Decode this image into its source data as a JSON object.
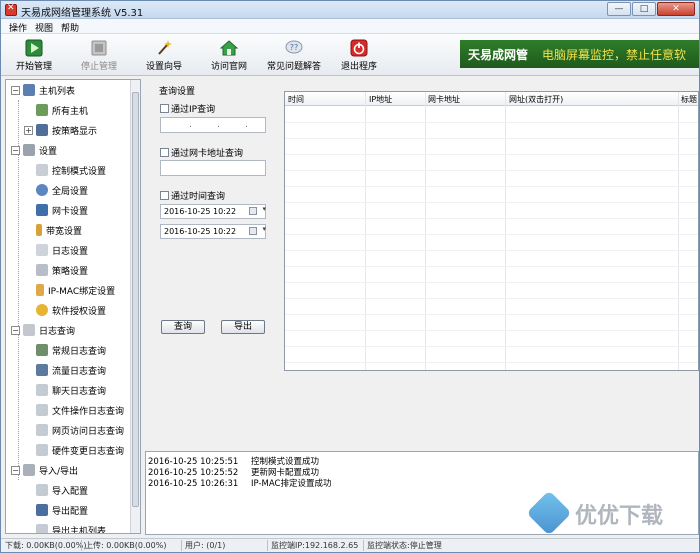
{
  "window": {
    "title": "天易成网络管理系统 V5.31"
  },
  "menu": [
    "操作",
    "视图",
    "帮助"
  ],
  "toolbar": [
    {
      "label": "开始管理",
      "icon": "play-icon",
      "enabled": true
    },
    {
      "label": "停止管理",
      "icon": "stop-icon",
      "enabled": false
    },
    {
      "label": "设置向导",
      "icon": "wand-icon",
      "enabled": true
    },
    {
      "label": "访问官网",
      "icon": "home-icon",
      "enabled": true
    },
    {
      "label": "常见问题解答",
      "icon": "faq-icon",
      "enabled": true
    },
    {
      "label": "退出程序",
      "icon": "power-icon",
      "enabled": true
    }
  ],
  "banner": {
    "brand": "天易成网管",
    "slogan": "电脑屏幕监控，禁止任意软"
  },
  "tree": [
    {
      "label": "主机列表",
      "level": 0,
      "icon": "host-list-icon"
    },
    {
      "label": "所有主机",
      "level": 1,
      "icon": "all-hosts-icon"
    },
    {
      "label": "按策略显示",
      "level": 1,
      "icon": "policy-view-icon"
    },
    {
      "label": "设置",
      "level": 0,
      "icon": "wrench-icon"
    },
    {
      "label": "控制模式设置",
      "level": 1,
      "icon": "control-mode-icon"
    },
    {
      "label": "全局设置",
      "level": 1,
      "icon": "gear-icon"
    },
    {
      "label": "网卡设置",
      "level": 1,
      "icon": "nic-icon"
    },
    {
      "label": "带宽设置",
      "level": 1,
      "icon": "bandwidth-icon"
    },
    {
      "label": "日志设置",
      "level": 1,
      "icon": "log-settings-icon"
    },
    {
      "label": "策略设置",
      "level": 1,
      "icon": "policy-icon"
    },
    {
      "label": "IP-MAC绑定设置",
      "level": 1,
      "icon": "ip-mac-icon"
    },
    {
      "label": "软件授权设置",
      "level": 1,
      "icon": "license-icon"
    },
    {
      "label": "日志查询",
      "level": 0,
      "icon": "log-query-icon"
    },
    {
      "label": "常规日志查询",
      "level": 1,
      "icon": "regular-log-icon"
    },
    {
      "label": "流量日志查询",
      "level": 1,
      "icon": "traffic-log-icon"
    },
    {
      "label": "聊天日志查询",
      "level": 1,
      "icon": "chat-log-icon"
    },
    {
      "label": "文件操作日志查询",
      "level": 1,
      "icon": "file-log-icon"
    },
    {
      "label": "网页访问日志查询",
      "level": 1,
      "icon": "web-log-icon"
    },
    {
      "label": "硬件变更日志查询",
      "level": 1,
      "icon": "hardware-log-icon"
    },
    {
      "label": "导入/导出",
      "level": 0,
      "icon": "import-export-icon"
    },
    {
      "label": "导入配置",
      "level": 1,
      "icon": "import-icon"
    },
    {
      "label": "导出配置",
      "level": 1,
      "icon": "export-icon"
    },
    {
      "label": "导出主机列表",
      "level": 1,
      "icon": "export-hosts-icon"
    }
  ],
  "query": {
    "title": "查询设置",
    "by_ip_label": "通过IP查询",
    "ip_dots": [
      ".",
      ".",
      "."
    ],
    "by_mac_label": "通过网卡地址查询",
    "by_time_label": "通过时间查询",
    "start_time": "2016-10-25 10:22",
    "end_time": "2016-10-25 10:22",
    "search_button": "查询",
    "export_button": "导出"
  },
  "results": {
    "columns": [
      "时间",
      "IP地址",
      "网卡地址",
      "网址(双击打开)",
      "标题"
    ]
  },
  "log": [
    {
      "time": "2016-10-25 10:25:51",
      "message": "控制模式设置成功"
    },
    {
      "time": "2016-10-25 10:25:52",
      "message": "更新网卡配置成功"
    },
    {
      "time": "2016-10-25 10:26:31",
      "message": "IP-MAC排定设置成功"
    }
  ],
  "status": {
    "download": "下载: 0.00KB(0.00%)",
    "upload": "上传: 0.00KB(0.00%)",
    "users": "用户: (0/1)",
    "monitor_ip": "监控端IP:192.168.2.65",
    "monitor_state": "监控端状态:停止管理"
  },
  "watermark": "优优下载"
}
